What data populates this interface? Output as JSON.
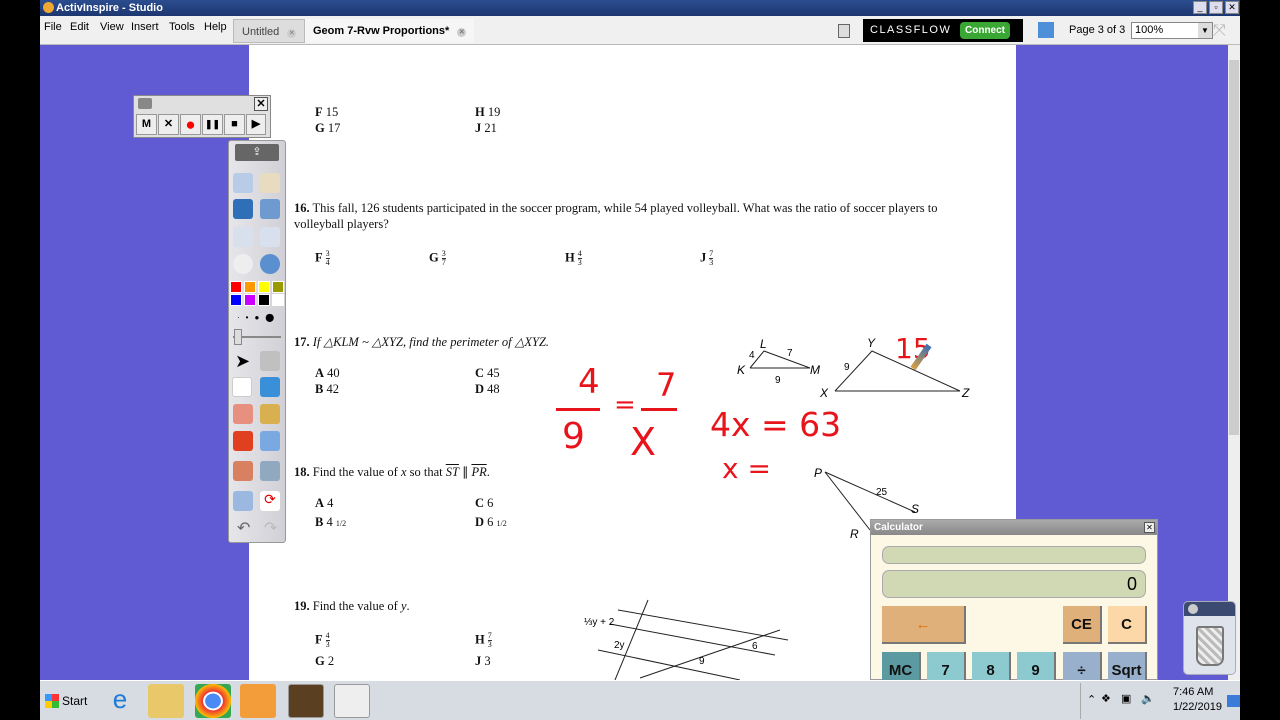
{
  "window": {
    "title": "ActivInspire - Studio"
  },
  "menu": [
    "File",
    "Edit",
    "View",
    "Insert",
    "Tools",
    "Help"
  ],
  "tabs": [
    {
      "label": "Untitled",
      "active": false
    },
    {
      "label": "Geom 7-Rvw Proportions*",
      "active": true
    }
  ],
  "toolbar": {
    "classflow": "CLASSFLOW",
    "connect": "Connect",
    "page_status": "Page 3 of 3",
    "zoom": "100%"
  },
  "recorder": {
    "buttons": [
      "M",
      "✕",
      "●",
      "❚❚",
      "■",
      "▶"
    ]
  },
  "toolbox": {
    "colors": [
      "#ff0000",
      "#ff9900",
      "#ffff00",
      "#999900",
      "#0000ff",
      "#cc00ff",
      "#000000",
      "#ffffff"
    ],
    "active_tool": "pen"
  },
  "document": {
    "q15": {
      "options": [
        {
          "letter": "F",
          "value": "15"
        },
        {
          "letter": "G",
          "value": "17"
        },
        {
          "letter": "H",
          "value": "19"
        },
        {
          "letter": "J",
          "value": "21"
        }
      ]
    },
    "q16": {
      "number": "16.",
      "text": "This fall, 126 students participated in the soccer program, while 54 played volleyball. What was the ratio of soccer players to volleyball players?",
      "options": [
        {
          "letter": "F",
          "num": "3",
          "den": "4"
        },
        {
          "letter": "G",
          "num": "3",
          "den": "7"
        },
        {
          "letter": "H",
          "num": "4",
          "den": "3"
        },
        {
          "letter": "J",
          "num": "7",
          "den": "3"
        }
      ]
    },
    "q17": {
      "number": "17.",
      "text": "If △KLM ~ △XYZ, find the perimeter of △XYZ.",
      "options": [
        {
          "letter": "A",
          "value": "40"
        },
        {
          "letter": "B",
          "value": "42"
        },
        {
          "letter": "C",
          "value": "45"
        },
        {
          "letter": "D",
          "value": "48"
        }
      ],
      "figure": {
        "small": {
          "K": "K",
          "L": "L",
          "M": "M",
          "KL": "4",
          "LM": "7",
          "KM": "9"
        },
        "large": {
          "X": "X",
          "Y": "Y",
          "Z": "Z",
          "XY": "9"
        }
      }
    },
    "q18": {
      "number": "18.",
      "text_before": "Find the value of",
      "var": "x",
      "text_mid": "so that",
      "seg1": "ST",
      "par": "∥",
      "seg2": "PR",
      "options": [
        {
          "letter": "A",
          "value": "4"
        },
        {
          "letter": "B",
          "value": "4",
          "frac": "1/2"
        },
        {
          "letter": "C",
          "value": "6"
        },
        {
          "letter": "D",
          "value": "6",
          "frac": "1/2"
        }
      ],
      "figure": {
        "P": "P",
        "R": "R",
        "S": "S",
        "PS": "25"
      }
    },
    "q19": {
      "number": "19.",
      "text_before": "Find the value of",
      "var": "y",
      "options": [
        {
          "letter": "F",
          "num": "4",
          "den": "3"
        },
        {
          "letter": "G",
          "value": "2"
        },
        {
          "letter": "H",
          "num": "7",
          "den": "3"
        },
        {
          "letter": "J",
          "value": "3"
        }
      ],
      "figure": {
        "l1": "⅓y + 2",
        "l2": "2y",
        "l3": "6",
        "l4": "9"
      }
    }
  },
  "handwriting": {
    "frac1_num": "4",
    "frac1_den": "9",
    "eq": "=",
    "frac2_num": "7",
    "frac2_den": "X",
    "line1": "4x = 63",
    "line2": "x =",
    "yz": "15",
    "color": "#e8141b"
  },
  "calculator": {
    "title": "Calculator",
    "memory_display": "",
    "display": "0",
    "buttons": [
      "←",
      "CE",
      "C",
      "MC",
      "7",
      "8",
      "9",
      "÷",
      "Sqrt"
    ]
  },
  "taskbar": {
    "start": "Start",
    "time": "7:46 AM",
    "date": "1/22/2019"
  }
}
